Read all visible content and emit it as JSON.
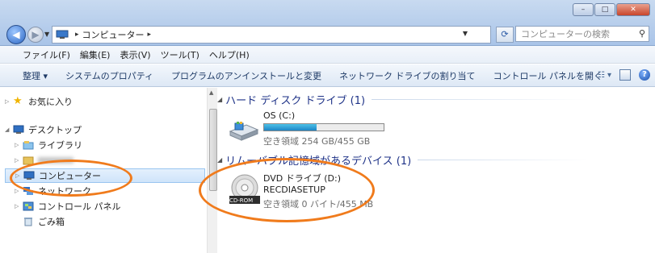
{
  "window": {
    "controls": {
      "minimize": "–",
      "maximize": "□",
      "close": "✕"
    }
  },
  "address": {
    "path": "コンピューター",
    "arrow": "▸"
  },
  "search": {
    "placeholder": "コンピューターの検索"
  },
  "menubar": {
    "items": [
      "ファイル(F)",
      "編集(E)",
      "表示(V)",
      "ツール(T)",
      "ヘルプ(H)"
    ]
  },
  "commandbar": {
    "items": [
      "整理 ▾",
      "システムのプロパティ",
      "プログラムのアンインストールと変更",
      "ネットワーク ドライブの割り当て",
      "コントロール パネルを開く"
    ]
  },
  "navpane": {
    "favorites": "お気に入り",
    "desktop": "デスクトップ",
    "libraries": "ライブラリ",
    "user": "",
    "computer": "コンピューター",
    "network": "ネットワーク",
    "control_panel": "コントロール パネル",
    "recycle_bin": "ごみ箱"
  },
  "main": {
    "hdd_header": "ハード ディスク ドライブ (1)",
    "os_drive": {
      "name": "OS (C:)",
      "free": "空き領域 254 GB/455 GB",
      "used_fraction": 0.44
    },
    "removable_header": "リムーバブル記憶域があるデバイス (1)",
    "dvd_drive": {
      "name": "DVD ドライブ (D:)",
      "label": "RECDIASETUP",
      "free": "空き領域 0 バイト/455 MB",
      "badge": "CD-ROM"
    }
  },
  "colors": {
    "annotation": "#f07b1c",
    "selection": "#cfe4fa",
    "group_header": "#1e3287"
  }
}
